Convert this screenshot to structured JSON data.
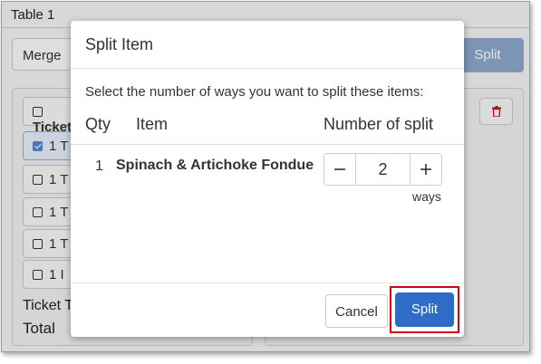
{
  "window": {
    "title": "Table 1"
  },
  "background": {
    "merge_label": "Merge",
    "split_label": "Split",
    "header_row_label": "Ticket",
    "rows": [
      {
        "label": "1 T",
        "selected": true
      },
      {
        "label": "1 T",
        "selected": false
      },
      {
        "label": "1 T",
        "selected": false
      },
      {
        "label": "1 T",
        "selected": false
      },
      {
        "label": "1 I",
        "selected": false
      }
    ],
    "ticket_label": "Ticket T",
    "total_label": "Total",
    "trash_icon": "trash-icon"
  },
  "dialog": {
    "title": "Split Item",
    "instruction": "Select the number of ways you want to split these items:",
    "columns": {
      "qty": "Qty",
      "item": "Item",
      "split": "Number of split"
    },
    "item": {
      "qty": "1",
      "name": "Spinach & Artichoke Fondue",
      "split_value": "2",
      "unit": "ways"
    },
    "stepper_icons": {
      "decrement": "minus-icon",
      "increment": "plus-icon"
    },
    "buttons": {
      "cancel": "Cancel",
      "split": "Split"
    },
    "highlight_color": "#d0021b",
    "primary_color": "#2f6cc7"
  }
}
